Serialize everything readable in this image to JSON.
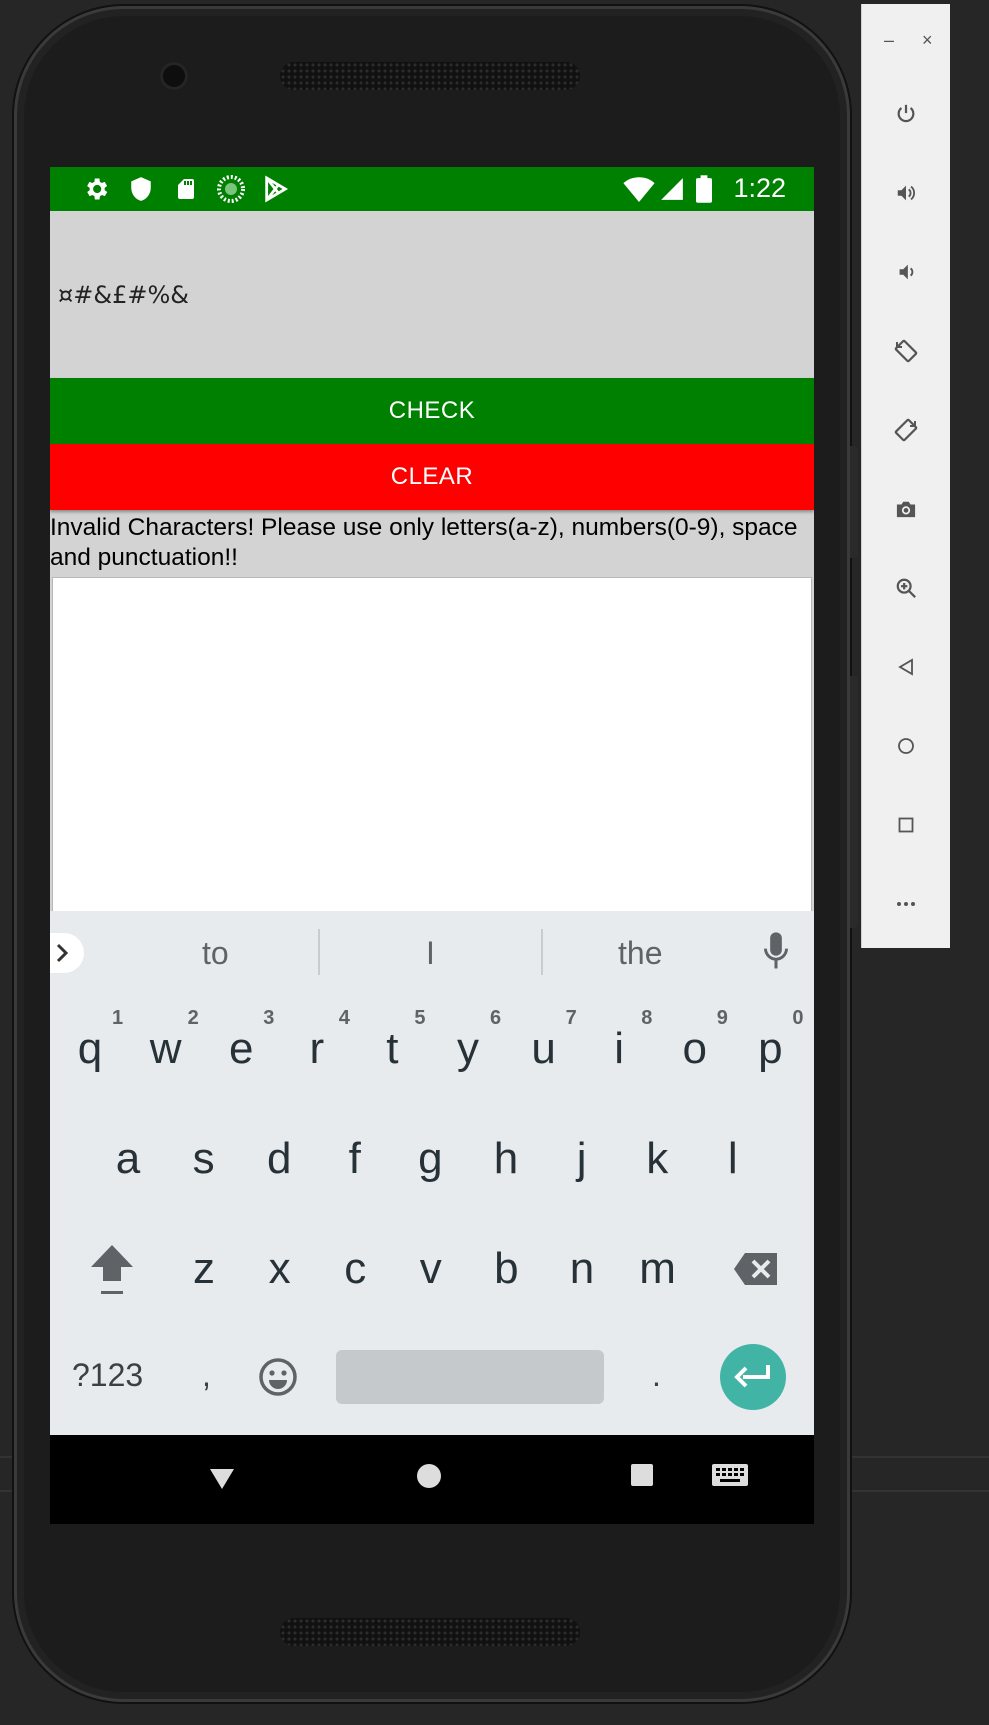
{
  "app": {
    "status_time": "1:22",
    "input_value": "¤#&£#%&",
    "check_label": "CHECK",
    "clear_label": "CLEAR",
    "message": "Invalid Characters! Please use only letters(a-z), numbers(0-9), space and punctuation!!",
    "output_value": ""
  },
  "colors": {
    "status_bar": "#008000",
    "check_button": "#008000",
    "clear_button": "#ff0000",
    "background": "#d3d3d3",
    "enter_key": "#42b4a5"
  },
  "status_icons": [
    "settings-icon",
    "shield-icon",
    "sd-card-icon",
    "sync-icon",
    "play-store-icon",
    "wifi-icon",
    "signal-icon",
    "battery-icon"
  ],
  "keyboard": {
    "suggestions": [
      "to",
      "I",
      "the"
    ],
    "row1": [
      "q",
      "w",
      "e",
      "r",
      "t",
      "y",
      "u",
      "i",
      "o",
      "p"
    ],
    "row1_hints": [
      "1",
      "2",
      "3",
      "4",
      "5",
      "6",
      "7",
      "8",
      "9",
      "0"
    ],
    "row2": [
      "a",
      "s",
      "d",
      "f",
      "g",
      "h",
      "j",
      "k",
      "l"
    ],
    "row3": [
      "z",
      "x",
      "c",
      "v",
      "b",
      "n",
      "m"
    ],
    "symbols_label": "?123",
    "comma": ",",
    "period": "."
  },
  "emulator_panel": {
    "minimize": "–",
    "close": "×",
    "buttons": [
      "power-icon",
      "volume-up-icon",
      "volume-down-icon",
      "rotate-left-icon",
      "rotate-right-icon",
      "camera-icon",
      "zoom-icon",
      "back-icon",
      "home-icon",
      "overview-icon",
      "more-icon"
    ]
  }
}
